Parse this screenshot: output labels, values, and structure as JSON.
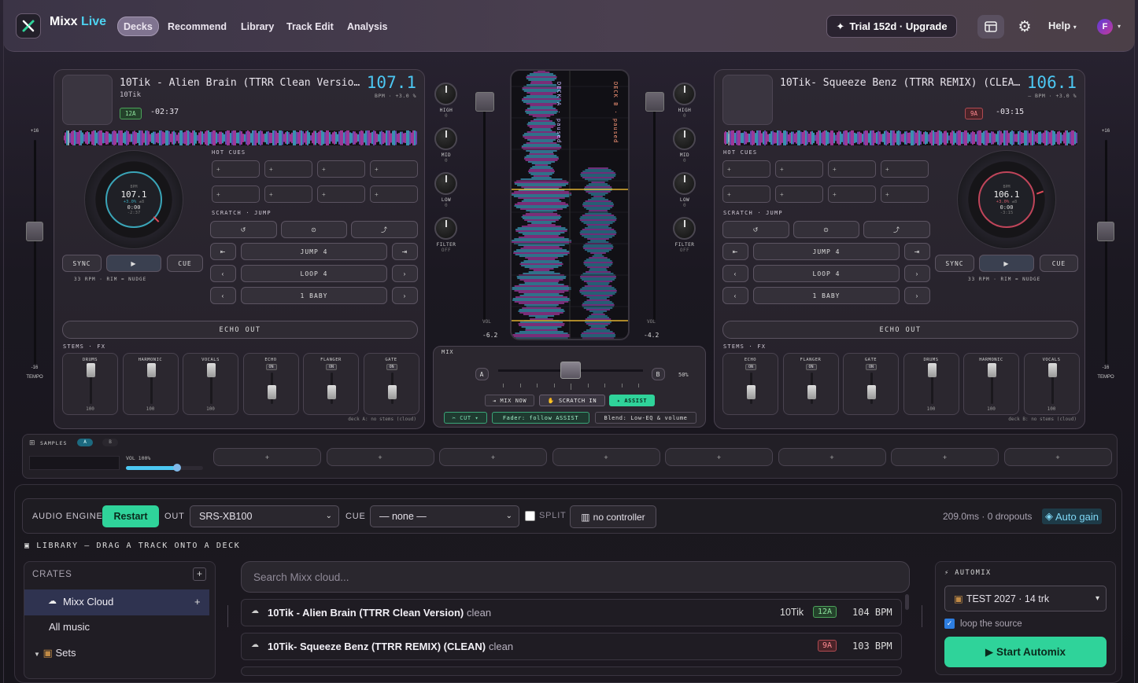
{
  "app": {
    "brand_main": "Mixx",
    "brand_accent": "Live"
  },
  "nav": {
    "items": [
      "Decks",
      "Recommend",
      "Library",
      "Track Edit",
      "Analysis"
    ],
    "active": "Decks"
  },
  "topbar": {
    "trial_label": "Trial 152d · Upgrade",
    "help_label": "Help",
    "avatar_letter": "F"
  },
  "deckA": {
    "title": "10Tik - Alien Brain (TTRR Clean Versio…",
    "artist": "10Tik",
    "bpm": "107.1",
    "bpm_sub": "BPM · +3.0 %",
    "key": "12A",
    "remaining": "-02:37",
    "jog": {
      "bpm_label": "BPM",
      "bpm": "107.1",
      "pitch": "+3.0%",
      "range": "±8",
      "time": "0:00",
      "neg": "-2:37"
    },
    "rpm": "33 RPM · RIM = NUDGE",
    "stems": [
      {
        "name": "DRUMS",
        "value": "100"
      },
      {
        "name": "HARMONIC",
        "value": "100"
      },
      {
        "name": "VOCALS",
        "value": "100"
      },
      {
        "name": "ECHO",
        "on": "ON"
      },
      {
        "name": "FLANGER",
        "on": "ON"
      },
      {
        "name": "GATE",
        "on": "ON"
      }
    ],
    "footnote": "deck A: no stems (cloud)"
  },
  "deckB": {
    "title": "10Tik- Squeeze Benz (TTRR REMIX) (CLEA…",
    "artist": "",
    "bpm": "106.1",
    "bpm_sub": "— BPM · +3.0 %",
    "key": "9A",
    "remaining": "-03:15",
    "jog": {
      "bpm_label": "BPM",
      "bpm": "106.1",
      "pitch": "+3.0%",
      "range": "±8",
      "time": "0:00",
      "neg": "-3:15"
    },
    "rpm": "33 RPM · RIM = NUDGE",
    "stems": [
      {
        "name": "ECHO",
        "on": "ON"
      },
      {
        "name": "FLANGER",
        "on": "ON"
      },
      {
        "name": "GATE",
        "on": "ON"
      },
      {
        "name": "DRUMS",
        "value": "100"
      },
      {
        "name": "HARMONIC",
        "value": "100"
      },
      {
        "name": "VOCALS",
        "value": "100"
      }
    ],
    "footnote": "deck B: no stems (cloud)"
  },
  "deck_common": {
    "hot_cues": "HOT CUES",
    "scratch_jump": "SCRATCH · JUMP",
    "jump": "JUMP 4",
    "loop": "LOOP 4",
    "baby": "1 BABY",
    "echo_out": "ECHO OUT",
    "stems_fx": "STEMS · FX",
    "sync": "SYNC",
    "cue": "CUE",
    "play": "▶",
    "tempo_top": "+16",
    "tempo_bottom": "-16",
    "tempo_label": "TEMPO",
    "cue_plus": "+"
  },
  "center": {
    "eq": [
      "HIGH",
      "MID",
      "LOW",
      "FILTER"
    ],
    "eq_val": "0",
    "filter_val": "OFF",
    "volA": "-6.2",
    "volB": "-4.2",
    "vol_label": "VOL",
    "deckA_label": "DECK A · paused",
    "deckB_label": "DECK B · paused",
    "mix_title": "MIX",
    "mix_a": "A",
    "mix_b": "B",
    "mix_pct": "50%",
    "crossfader_position": 0.5,
    "mix_now": "⇥ MIX NOW",
    "scratch_in": "✋ SCRATCH IN",
    "assist": "✦ ASSIST",
    "cut": "✂ CUT ▾",
    "fader_follow": "Fader: follow ASSIST",
    "blend": "Blend: Low-EQ & volume"
  },
  "samples": {
    "label": "SAMPLES",
    "tab_a": "A",
    "tab_b": "B",
    "vol_label": "VOL 100%",
    "volume": 1.0,
    "pad_label": "+"
  },
  "engine": {
    "audio_engine": "AUDIO ENGINE",
    "restart": "Restart",
    "out_label": "OUT",
    "out_value": "SRS-XB100",
    "cue_label": "CUE",
    "cue_value": "— none —",
    "split": "SPLIT",
    "controller": "no controller",
    "stats": "209.0ms · 0 dropouts",
    "auto_gain": "Auto gain"
  },
  "library": {
    "header": "LIBRARY — DRAG A TRACK ONTO A DECK",
    "crates_label": "CRATES",
    "crates": [
      "Mixx Cloud",
      "All music",
      "Sets"
    ],
    "search_placeholder": "Search Mixx cloud...",
    "tracks": [
      {
        "title": "10Tik - Alien Brain (TTRR Clean Version)",
        "tag": "clean",
        "artist": "10Tik",
        "key": "12A",
        "bpm": "104 BPM"
      },
      {
        "title": "10Tik- Squeeze Benz (TTRR REMIX) (CLEAN)",
        "tag": "clean",
        "artist": "",
        "key": "9A",
        "bpm": "103 BPM"
      }
    ]
  },
  "automix": {
    "title": "AUTOMIX",
    "source": "TEST 2027 · 14 trk",
    "loop_label": "loop the source",
    "start": "▶ Start Automix"
  },
  "colors": {
    "accent_cyan": "#4cc7f2",
    "green": "#2fd39a",
    "magenta": "#d84ad0"
  }
}
